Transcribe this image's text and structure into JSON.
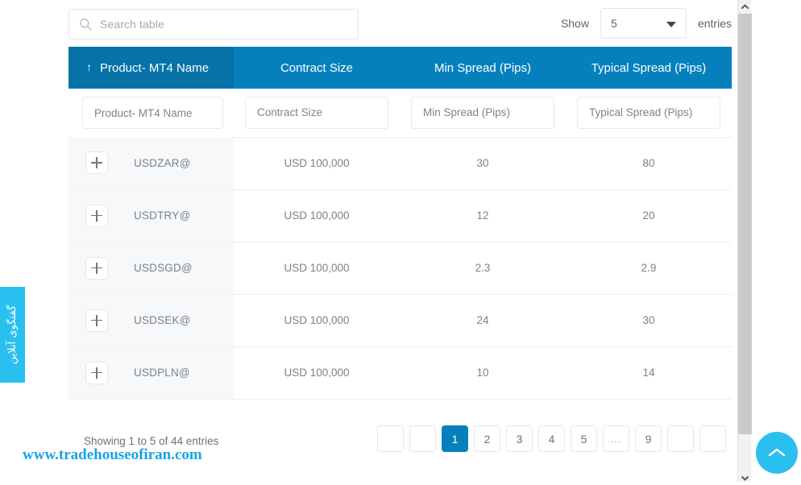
{
  "toolbar": {
    "search_placeholder": "Search table",
    "search_value": "",
    "search_icon": "search-icon",
    "show_label": "Show",
    "entries_selected": "5",
    "entries_label": "entries",
    "caret_icon": "chevron-down-icon"
  },
  "table": {
    "sort_icon": "arrow-up-icon",
    "columns": [
      {
        "label": "Product- MT4 Name",
        "filter_placeholder": "Product- MT4 Name",
        "sorted": true
      },
      {
        "label": "Contract Size",
        "filter_placeholder": "Contract Size",
        "sorted": false
      },
      {
        "label": "Min Spread (Pips)",
        "filter_placeholder": "Min Spread (Pips)",
        "sorted": false
      },
      {
        "label": "Typical Spread (Pips)",
        "filter_placeholder": "Typical Spread (Pips)",
        "sorted": false
      }
    ],
    "expand_icon": "plus-icon",
    "rows": [
      {
        "name": "USDZAR@",
        "contract_size": "USD 100,000",
        "min_spread": "30",
        "typical_spread": "80"
      },
      {
        "name": "USDTRY@",
        "contract_size": "USD 100,000",
        "min_spread": "12",
        "typical_spread": "20"
      },
      {
        "name": "USDSGD@",
        "contract_size": "USD 100,000",
        "min_spread": "2.3",
        "typical_spread": "2.9"
      },
      {
        "name": "USDSEK@",
        "contract_size": "USD 100,000",
        "min_spread": "24",
        "typical_spread": "30"
      },
      {
        "name": "USDPLN@",
        "contract_size": "USD 100,000",
        "min_spread": "10",
        "typical_spread": "14"
      }
    ]
  },
  "footer": {
    "showing_text": "Showing 1 to 5 of 44 entries",
    "pagination": [
      {
        "label": "",
        "name": "page-first",
        "active": false,
        "ellipsis": false
      },
      {
        "label": "",
        "name": "page-prev",
        "active": false,
        "ellipsis": false
      },
      {
        "label": "1",
        "name": "page-1",
        "active": true,
        "ellipsis": false
      },
      {
        "label": "2",
        "name": "page-2",
        "active": false,
        "ellipsis": false
      },
      {
        "label": "3",
        "name": "page-3",
        "active": false,
        "ellipsis": false
      },
      {
        "label": "4",
        "name": "page-4",
        "active": false,
        "ellipsis": false
      },
      {
        "label": "5",
        "name": "page-5",
        "active": false,
        "ellipsis": false
      },
      {
        "label": "...",
        "name": "page-ellipsis",
        "active": false,
        "ellipsis": true
      },
      {
        "label": "9",
        "name": "page-9",
        "active": false,
        "ellipsis": false
      },
      {
        "label": "",
        "name": "page-next",
        "active": false,
        "ellipsis": false
      },
      {
        "label": "",
        "name": "page-last",
        "active": false,
        "ellipsis": false
      }
    ]
  },
  "chat_tab": {
    "label": "گفتگوی آنلاین"
  },
  "watermark": {
    "text": "www.tradehouseofiran.com"
  },
  "scroll_top_button": {
    "icon": "chevron-up-icon"
  },
  "scrollbar": {
    "up_icon": "chevron-up-icon",
    "down_icon": "chevron-down-icon"
  },
  "colors": {
    "header_blue": "#0680bd",
    "header_blue_sorted": "#0672a8",
    "accent_cyan": "#29c0ef",
    "watermark_blue": "#19a3e8",
    "row_alt_bg": "#f6f8fa"
  }
}
